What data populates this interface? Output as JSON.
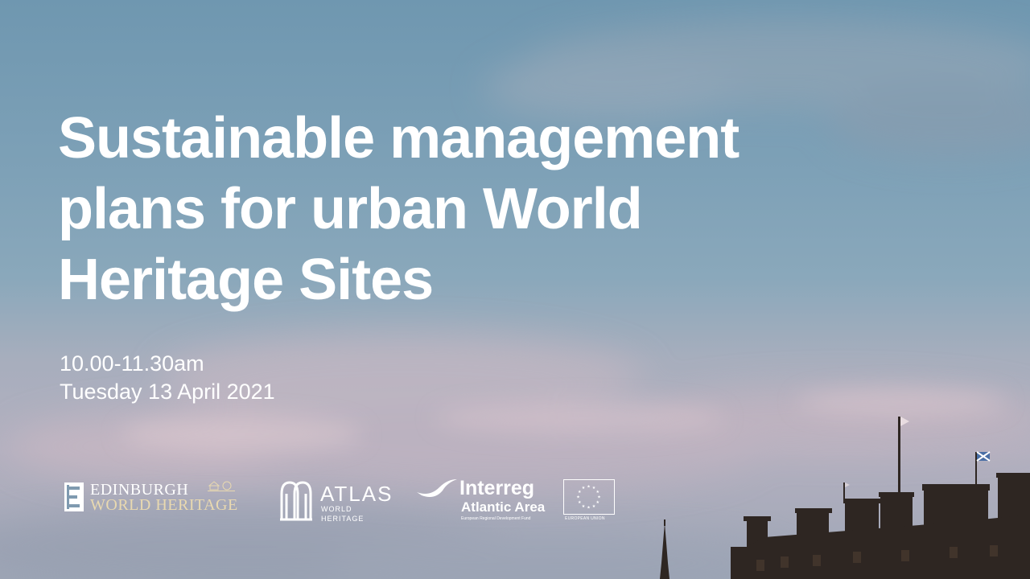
{
  "slide": {
    "title": "Sustainable management plans for urban World Heritage Sites",
    "time": "10.00-11.30am",
    "date": "Tuesday 13 April 2021"
  },
  "logos": {
    "edinburgh": {
      "line1": "EDINBURGH",
      "line2": "WORLD HERITAGE"
    },
    "atlas": {
      "name": "ATLAS",
      "sub": "WORLD HERITAGE"
    },
    "interreg": {
      "name": "Interreg",
      "area": "Atlantic Area",
      "fund": "European Regional Development Fund",
      "eu": "EUROPEAN UNION"
    }
  },
  "colors": {
    "text": "#ffffff",
    "sky_top": "#6f97b0",
    "sky_bottom": "#b3b0bf",
    "edinburgh_gold": "#e9d9b0",
    "buildings": "#2e2622"
  },
  "icons": {
    "edinburgh_mark": "edinburgh-e-icon",
    "atlas_mark": "atlas-arches-icon",
    "interreg_mark": "interreg-swoosh-icon",
    "eu_flag": "eu-stars-icon",
    "flag_saltire": "scottish-flag-icon"
  }
}
